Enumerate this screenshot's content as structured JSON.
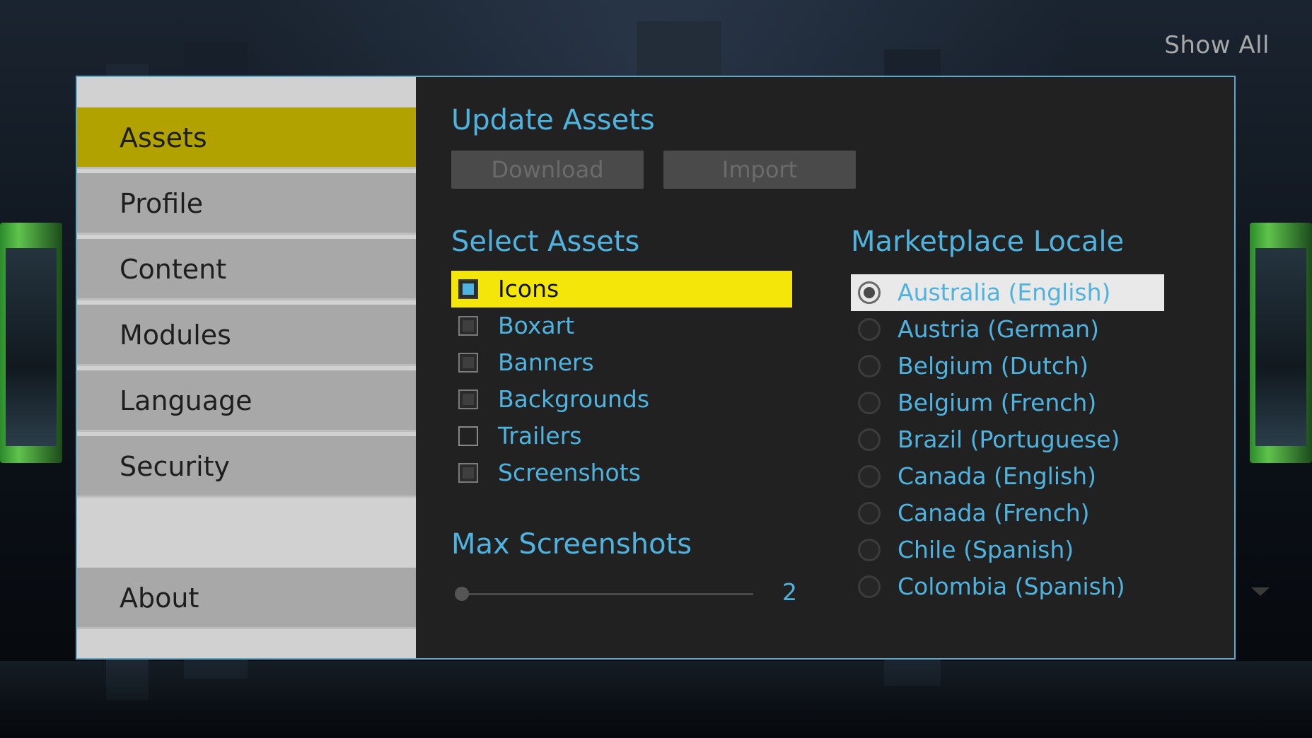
{
  "header": {
    "show_all_label": "Show All"
  },
  "sidebar": {
    "items": [
      {
        "label": "Assets",
        "active": true
      },
      {
        "label": "Profile",
        "active": false
      },
      {
        "label": "Content",
        "active": false
      },
      {
        "label": "Modules",
        "active": false
      },
      {
        "label": "Language",
        "active": false
      },
      {
        "label": "Security",
        "active": false
      }
    ],
    "about_label": "About"
  },
  "update_assets": {
    "title": "Update Assets",
    "download_label": "Download",
    "import_label": "Import"
  },
  "select_assets": {
    "title": "Select Assets",
    "items": [
      {
        "label": "Icons",
        "state": "checked",
        "selected": true
      },
      {
        "label": "Boxart",
        "state": "indeterminate",
        "selected": false
      },
      {
        "label": "Banners",
        "state": "indeterminate",
        "selected": false
      },
      {
        "label": "Backgrounds",
        "state": "indeterminate",
        "selected": false
      },
      {
        "label": "Trailers",
        "state": "unchecked",
        "selected": false
      },
      {
        "label": "Screenshots",
        "state": "indeterminate",
        "selected": false
      }
    ]
  },
  "max_screenshots": {
    "title": "Max Screenshots",
    "value": "2",
    "fraction": 0.0
  },
  "marketplace_locale": {
    "title": "Marketplace Locale",
    "items": [
      {
        "label": "Australia (English)",
        "selected": true
      },
      {
        "label": "Austria (German)",
        "selected": false
      },
      {
        "label": "Belgium (Dutch)",
        "selected": false
      },
      {
        "label": "Belgium (French)",
        "selected": false
      },
      {
        "label": "Brazil (Portuguese)",
        "selected": false
      },
      {
        "label": "Canada (English)",
        "selected": false
      },
      {
        "label": "Canada (French)",
        "selected": false
      },
      {
        "label": "Chile (Spanish)",
        "selected": false
      },
      {
        "label": "Colombia (Spanish)",
        "selected": false
      }
    ]
  },
  "colors": {
    "accent": "#4fb3e0",
    "sidebar_active": "#b1a200",
    "row_highlight": "#f5e60a"
  }
}
